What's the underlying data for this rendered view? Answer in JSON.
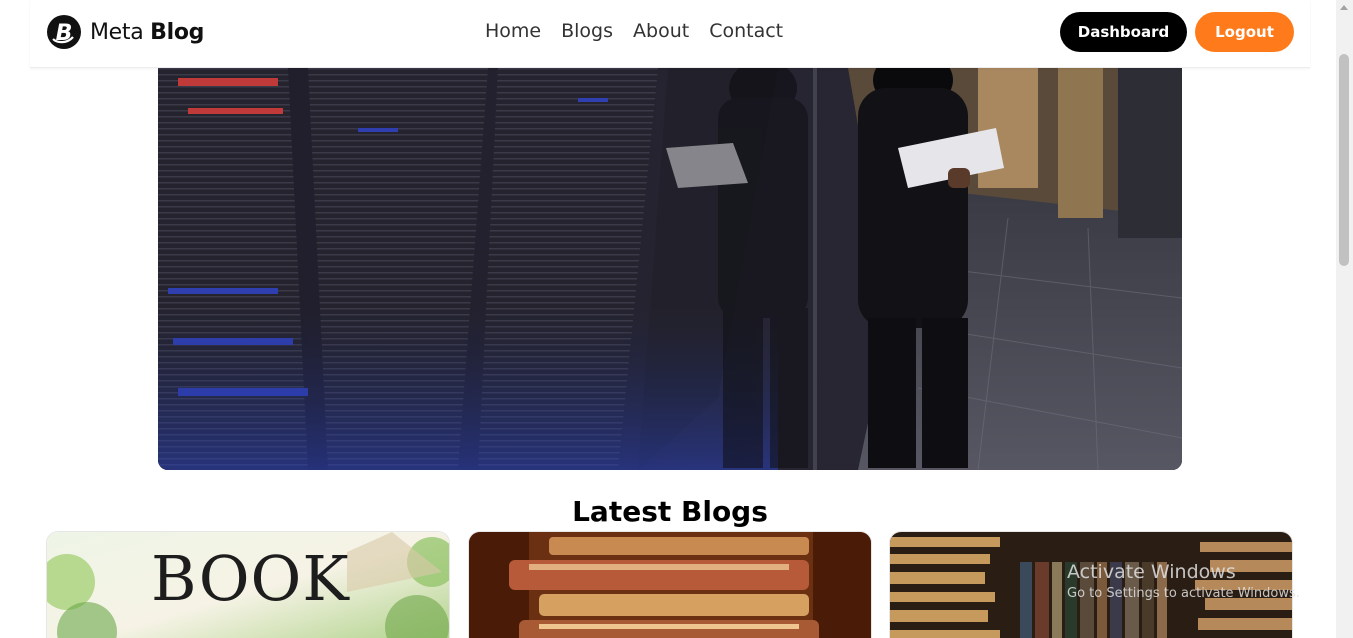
{
  "header": {
    "logo": {
      "prefix": "Meta",
      "bold": "Blog",
      "mark_letter": "B"
    },
    "nav": [
      "Home",
      "Blogs",
      "About",
      "Contact"
    ],
    "dashboard_label": "Dashboard",
    "logout_label": "Logout"
  },
  "hero": {
    "image": "woman-with-laptop-in-server-room"
  },
  "latest": {
    "title": "Latest Blogs",
    "cards": [
      {
        "image": "book-cover-cottage",
        "image_text": "BOOK"
      },
      {
        "image": "stack-of-old-books"
      },
      {
        "image": "library-bookshelves"
      }
    ]
  },
  "watermark": {
    "title": "Activate Windows",
    "subtitle": "Go to Settings to activate Windows."
  },
  "colors": {
    "accent": "#ff7a1a",
    "dark": "#000000"
  }
}
